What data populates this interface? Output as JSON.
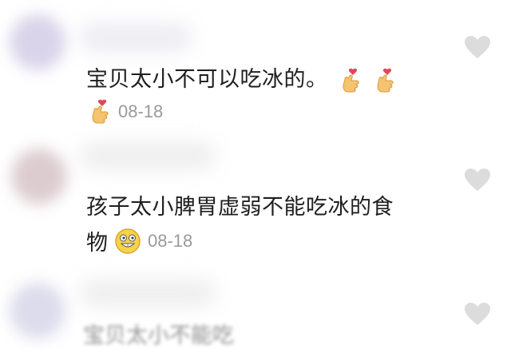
{
  "comments": [
    {
      "text": "宝贝太小不可以吃冰的。",
      "time": "08-18",
      "trailing_icons": [
        "finger-heart-icon",
        "finger-heart-icon"
      ],
      "meta_icon": "finger-heart-icon"
    },
    {
      "text_line1": "孩子太小脾胃虚弱不能吃冰的食",
      "text_line2": "物",
      "time": "08-18",
      "meta_icon": "grin-face-icon"
    },
    {
      "partial_text": "宝贝太小不能吃"
    }
  ],
  "colors": {
    "heart": "#dcdcdc",
    "time": "#9a9a9a",
    "text": "#1f1f1f"
  }
}
